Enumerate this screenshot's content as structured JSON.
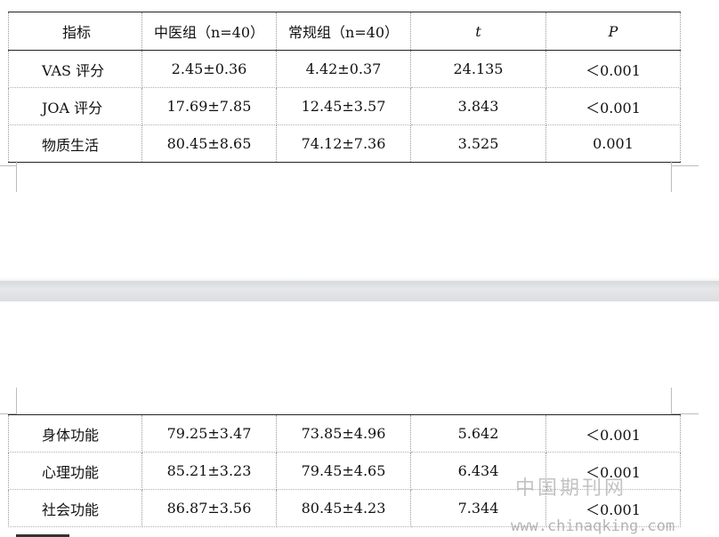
{
  "table": {
    "headers": [
      "指标",
      "中医组（n=40）",
      "常规组（n=40）",
      "t",
      "P"
    ],
    "rows_top": [
      [
        "VAS 评分",
        "2.45±0.36",
        "4.42±0.37",
        "24.135",
        "＜0.001"
      ],
      [
        "JOA 评分",
        "17.69±7.85",
        "12.45±3.57",
        "3.843",
        "＜0.001"
      ],
      [
        "物质生活",
        "80.45±8.65",
        "74.12±7.36",
        "3.525",
        "0.001"
      ]
    ],
    "rows_bottom": [
      [
        "身体功能",
        "79.25±3.47",
        "73.85±4.96",
        "5.642",
        "＜0.001"
      ],
      [
        "心理功能",
        "85.21±3.23",
        "79.45±4.65",
        "6.434",
        "＜0.001"
      ],
      [
        "社会功能",
        "86.87±3.56",
        "80.45±4.23",
        "7.344",
        "＜0.001"
      ]
    ]
  },
  "watermark": {
    "name": "中国期刊网",
    "url": "www.chinaqking.com"
  }
}
